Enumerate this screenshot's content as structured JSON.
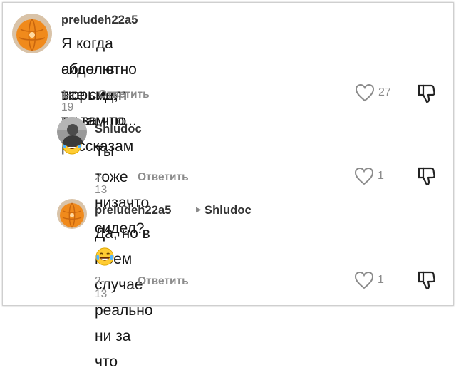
{
  "comments": [
    {
      "username": "preludeh22a5",
      "text_line1": "Я когда сидел в тюрьме, то там по рассказам",
      "text_line2": "абсолютно все сидят ни за что...",
      "emoji_icon": "laughing-tears-emoji",
      "date": "1-19",
      "reply_label": "Ответить",
      "likes": "27"
    },
    {
      "username": "Shludoc",
      "text_line1": "Ты тоже низачто сидел?",
      "date": "2-13",
      "reply_label": "Ответить",
      "likes": "1"
    },
    {
      "username": "preludeh22a5",
      "reply_to": "Shludoc",
      "text_line1": "Да, но в моем случае реально ни за что",
      "emoji_icon": "laughing-tears-emoji",
      "date": "2-13",
      "reply_label": "Ответить",
      "likes": "1"
    }
  ],
  "colors": {
    "text": "#161616",
    "meta": "#8b8b8b",
    "username": "#333333",
    "avatar_orange": "#f08a1c"
  }
}
